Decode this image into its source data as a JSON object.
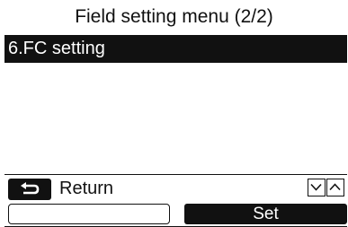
{
  "header": {
    "title": "Field setting menu (2/2)"
  },
  "menu": {
    "items": [
      {
        "label": "6.FC setting",
        "selected": true
      }
    ]
  },
  "footer": {
    "return_label": "Return",
    "return_icon": "return-arrow-icon",
    "nav_icons": [
      "chevron-down-icon",
      "chevron-up-icon"
    ],
    "left_button_label": "",
    "set_button_label": "Set"
  },
  "colors": {
    "foreground": "#111111",
    "background": "#ffffff"
  }
}
